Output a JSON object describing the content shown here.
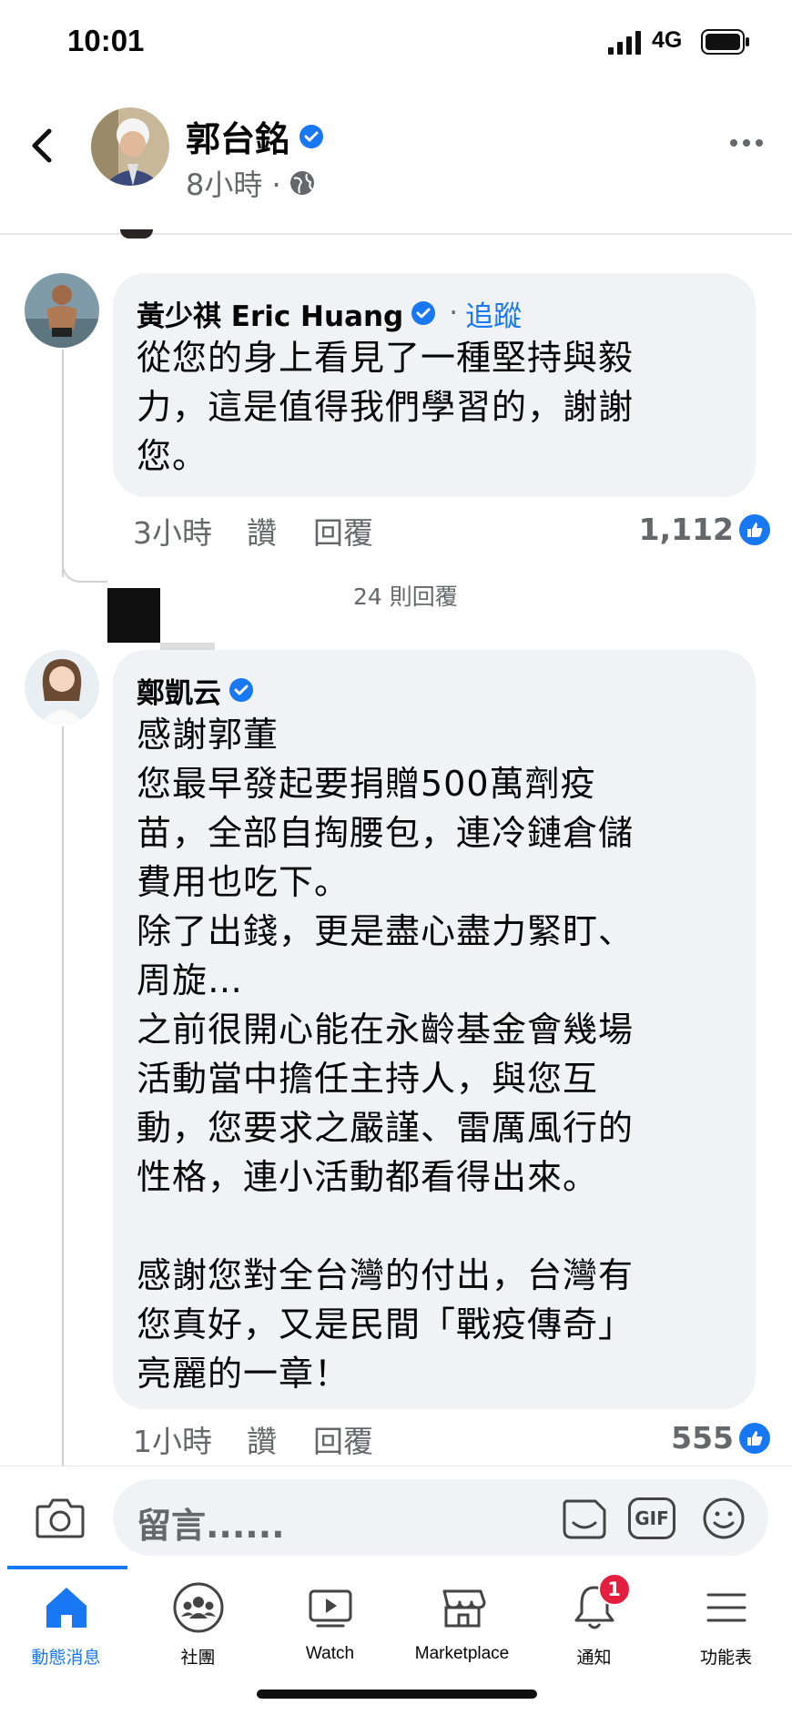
{
  "status_bar": {
    "time": "10:01",
    "network": "4G"
  },
  "header": {
    "name": "郭台銘",
    "meta": "8小時 ·"
  },
  "comments": [
    {
      "author": "黃少祺 Eric Huang",
      "follow_dot": "·",
      "follow": "追蹤",
      "text": "從您的身上看見了一種堅持與毅\n力，這是值得我們學習的，謝謝\n您。",
      "time": "3小時",
      "like": "讚",
      "reply": "回覆",
      "reactions": "1,112"
    },
    {
      "author": "鄭凱云",
      "text": "感謝郭董\n您最早發起要捐贈500萬劑疫\n苗，全部自掏腰包，連冷鏈倉儲\n費用也吃下。\n除了出錢，更是盡心盡力緊盯、\n周旋…\n之前很開心能在永齡基金會幾場\n活動當中擔任主持人，與您互\n動，您要求之嚴謹、雷厲風行的\n性格，連小活動都看得出來。\n\n感謝您對全台灣的付出，台灣有\n您真好，又是民間「戰疫傳奇」\n亮麗的一章！",
      "time": "1小時",
      "like": "讚",
      "reply": "回覆",
      "reactions": "555"
    }
  ],
  "replies_link": "24 則回覆",
  "composer": {
    "placeholder": "留言......",
    "gif": "GIF"
  },
  "nav": {
    "items": [
      {
        "label": "動態消息",
        "icon": "home-icon"
      },
      {
        "label": "社團",
        "icon": "groups-icon"
      },
      {
        "label": "Watch",
        "icon": "watch-icon"
      },
      {
        "label": "Marketplace",
        "icon": "marketplace-icon"
      },
      {
        "label": "通知",
        "icon": "bell-icon"
      },
      {
        "label": "功能表",
        "icon": "menu-icon"
      }
    ],
    "notification_count": "1"
  },
  "colors": {
    "accent": "#1877f2",
    "bubble": "#f0f2f5",
    "badge": "#e41e3f",
    "meta": "#65676b"
  }
}
